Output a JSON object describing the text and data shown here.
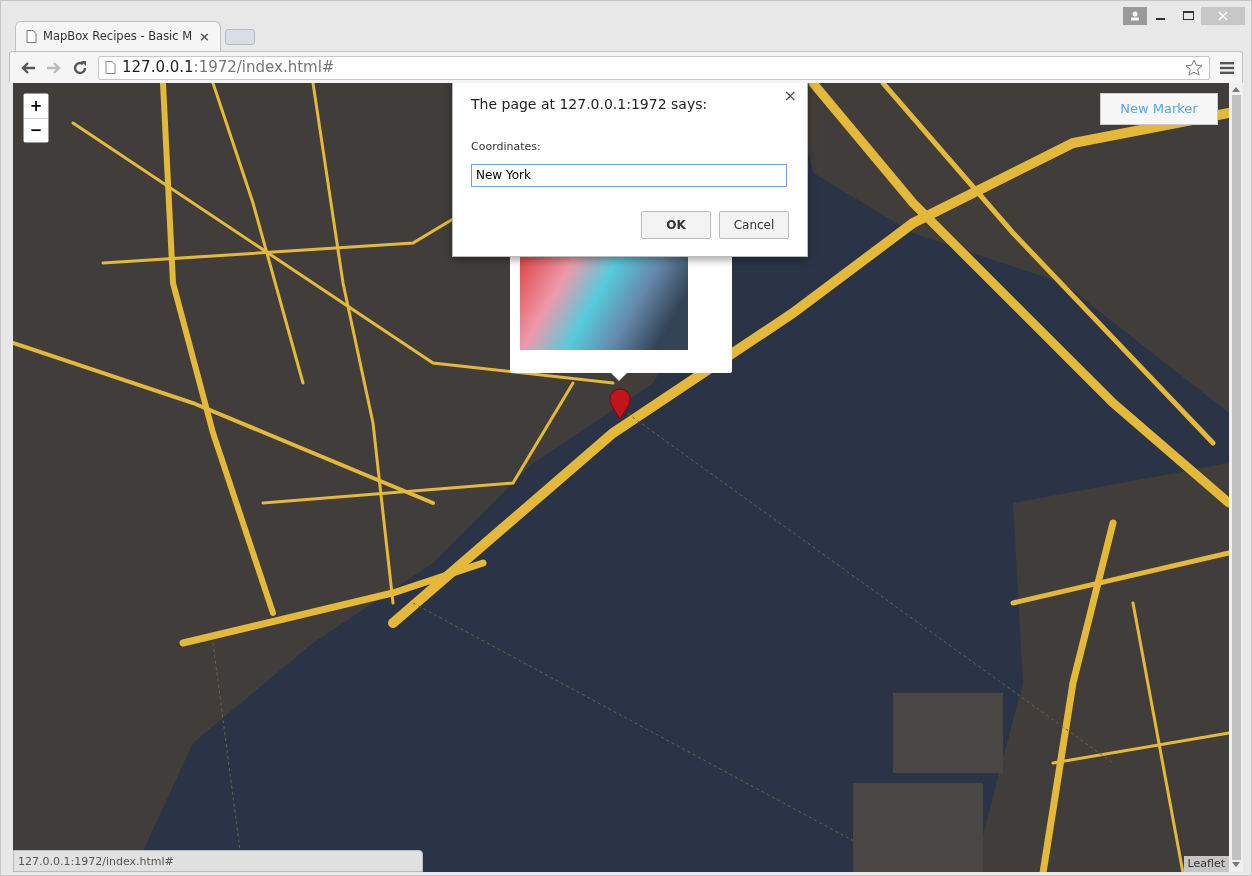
{
  "window": {
    "tab_title": "MapBox Recipes - Basic M",
    "tab_close": "×",
    "address": {
      "host": "127.0.0.1",
      "rest": ":1972/index.html#"
    }
  },
  "map": {
    "zoom_controls": [
      "+",
      "−"
    ],
    "new_marker_button": "New Marker",
    "attribution": "Leaflet"
  },
  "dialog": {
    "title": "The page at 127.0.0.1:1972 says:",
    "close": "×",
    "label": "Coordinates:",
    "value": "New York",
    "buttons": [
      {
        "label": "OK",
        "default": true
      },
      {
        "label": "Cancel",
        "default": false
      }
    ]
  },
  "status_bar": "127.0.0.1:1972/index.html#"
}
